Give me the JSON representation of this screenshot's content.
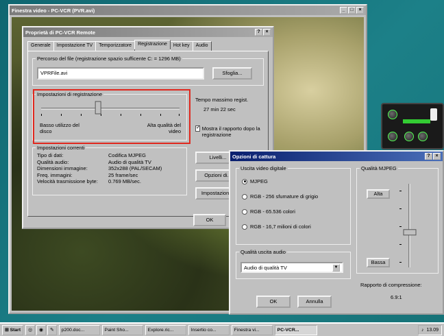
{
  "video_window": {
    "title": "Finestra video - PC-VCR (PVR.avi)",
    "buttons": [
      "_",
      "□",
      "×"
    ]
  },
  "props": {
    "title": "Proprietà di PC-VCR Remote",
    "tabs": [
      "Generale",
      "Impostazione TV",
      "Temporizzatore",
      "Registrazione",
      "Hot key",
      "Audio"
    ],
    "active_tab": "Registrazione",
    "path_label": "Percorso del file (registrazione spazio sufficente C: = 1296 MB)",
    "path_value": "VPRFile.avi",
    "browse_btn": "Sfoglia...",
    "rec_settings": {
      "label": "Impostazioni di registrazione",
      "left_label": "Basso utilizzo del disco",
      "right_label": "Alta qualità del video",
      "slider_position": 0.42
    },
    "max_time": {
      "label": "Tempo massimo regist.",
      "value": "27 min 22 sec"
    },
    "show_report": {
      "label": "Mostra il rapporto dopo la registrazione",
      "checked": true
    },
    "current": {
      "label": "Impostazioni correnti",
      "rows": [
        [
          "Tipo di dati:",
          "Codifica MJPEG"
        ],
        [
          "Qualità audio:",
          "Audio di qualità TV"
        ],
        [
          "Dimensioni immagine:",
          "352x288 (PAL/SECAM)"
        ],
        [
          "Freq. immagini:",
          "25 frame/sec"
        ],
        [
          "Velocità trasmissione byte:",
          "0.769 MB/sec."
        ]
      ]
    },
    "side_buttons": [
      "Livelli...",
      "Opzioni di...",
      "Impostazioni..."
    ],
    "ok": "OK"
  },
  "capture": {
    "title": "Opzioni di cattura",
    "video_group": "Uscita video digitale",
    "video_options": [
      "MJPEG",
      "RGB - 256 sfumature di grigio",
      "RGB - 65.536 colori",
      "RGB - 16,7 milioni di colori"
    ],
    "selected_video": "MJPEG",
    "audio_group": "Qualità uscita audio",
    "audio_value": "Audio di qualità TV",
    "mjpeg_group": "Qualità MJPEG",
    "high": "Alta",
    "low": "Bassa",
    "mjpeg_level": 0.4,
    "ratio_label": "Rapporto di compressione:",
    "ratio_value": "6.9:1",
    "ok": "OK",
    "cancel": "Annulla"
  },
  "taskbar": {
    "start": "Start",
    "items": [
      "p200.doc...",
      "Paint Sho...",
      "Explore.ric...",
      "Insertio co...",
      "Finestra vi...",
      "PC-VCR..."
    ],
    "active_item": "PC-VCR...",
    "clock": "13.09"
  }
}
